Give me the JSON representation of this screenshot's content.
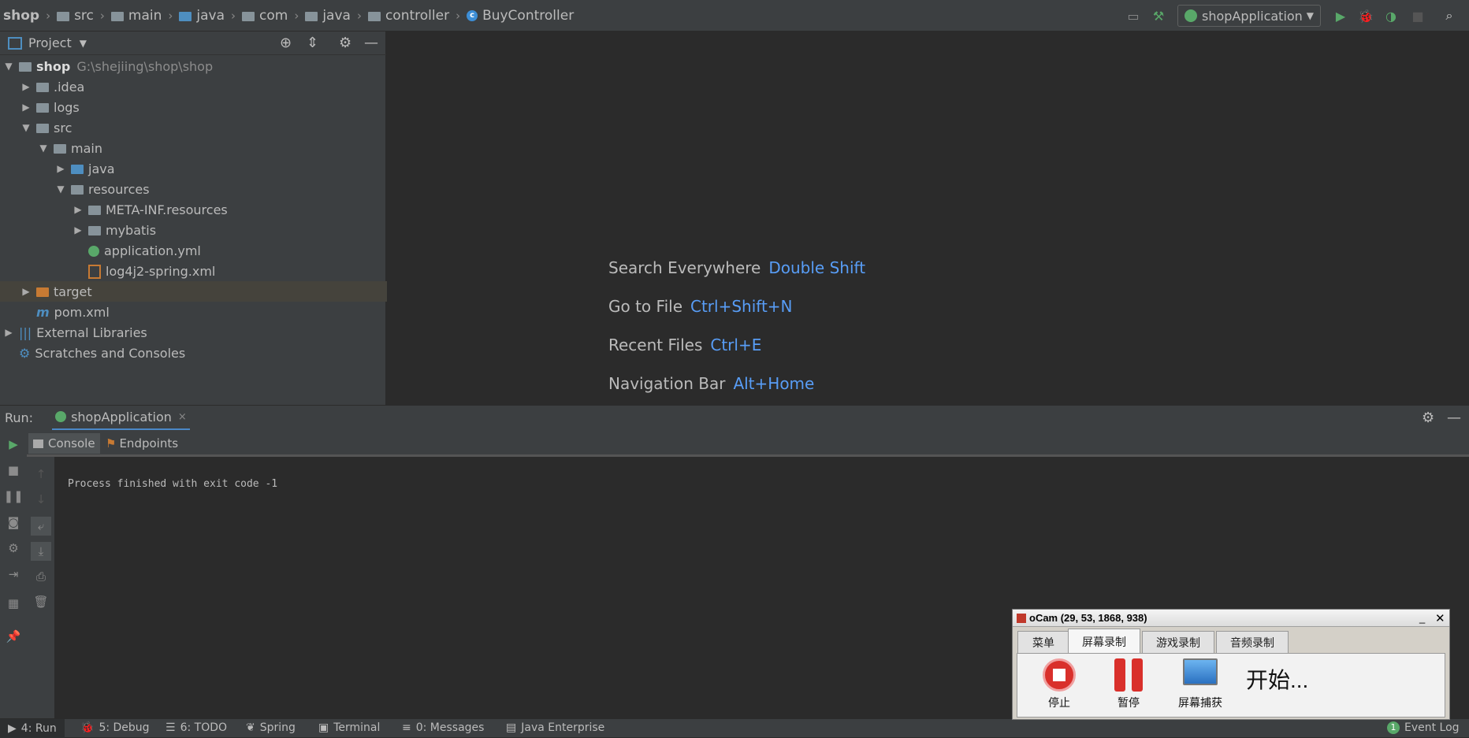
{
  "breadcrumb": {
    "items": [
      {
        "label": "shop",
        "icon": "folder-icon"
      },
      {
        "label": "src",
        "icon": "folder-icon"
      },
      {
        "label": "main",
        "icon": "folder-icon"
      },
      {
        "label": "java",
        "icon": "folder-icon"
      },
      {
        "label": "com",
        "icon": "package-icon"
      },
      {
        "label": "java",
        "icon": "package-icon"
      },
      {
        "label": "controller",
        "icon": "package-icon"
      },
      {
        "label": "BuyController",
        "icon": "class-icon"
      }
    ]
  },
  "toolbar": {
    "run_config": "shopApplication"
  },
  "project_panel": {
    "title": "Project",
    "root": {
      "name": "shop",
      "path": "G:\\shejiing\\shop\\shop"
    },
    "tree": [
      {
        "label": ".idea",
        "depth": 1,
        "expanded": false
      },
      {
        "label": "logs",
        "depth": 1,
        "expanded": false
      },
      {
        "label": "src",
        "depth": 1,
        "expanded": true
      },
      {
        "label": "main",
        "depth": 2,
        "expanded": true
      },
      {
        "label": "java",
        "depth": 3,
        "expanded": false
      },
      {
        "label": "resources",
        "depth": 3,
        "expanded": true
      },
      {
        "label": "META-INF.resources",
        "depth": 4,
        "expanded": false
      },
      {
        "label": "mybatis",
        "depth": 4,
        "expanded": false
      },
      {
        "label": "application.yml",
        "depth": 4
      },
      {
        "label": "log4j2-spring.xml",
        "depth": 4
      },
      {
        "label": "target",
        "depth": 1,
        "expanded": false
      },
      {
        "label": "pom.xml",
        "depth": 1
      },
      {
        "label": "External Libraries",
        "depth": 0,
        "expanded": false
      },
      {
        "label": "Scratches and Consoles",
        "depth": 0
      }
    ]
  },
  "editor_hints": [
    {
      "label": "Search Everywhere",
      "key": "Double Shift"
    },
    {
      "label": "Go to File",
      "key": "Ctrl+Shift+N"
    },
    {
      "label": "Recent Files",
      "key": "Ctrl+E"
    },
    {
      "label": "Navigation Bar",
      "key": "Alt+Home"
    }
  ],
  "run_panel": {
    "label": "Run:",
    "tab": "shopApplication",
    "subtabs": [
      "Console",
      "Endpoints"
    ],
    "console_output": "Process finished with exit code -1"
  },
  "statusbar": {
    "items": [
      "4: Run",
      "5: Debug",
      "6: TODO",
      "Spring",
      "Terminal",
      "0: Messages",
      "Java Enterprise"
    ],
    "event_log": "Event Log",
    "event_count": "1"
  },
  "ocam": {
    "title": "oCam (29, 53, 1868, 938)",
    "tabs": [
      "菜单",
      "屏幕录制",
      "游戏录制",
      "音频录制"
    ],
    "buttons": [
      "停止",
      "暂停",
      "屏幕捕获"
    ],
    "status": "开始..."
  },
  "colors": {
    "accent_blue": "#589df6",
    "run_green": "#59a869",
    "stop_red": "#d9302b"
  }
}
